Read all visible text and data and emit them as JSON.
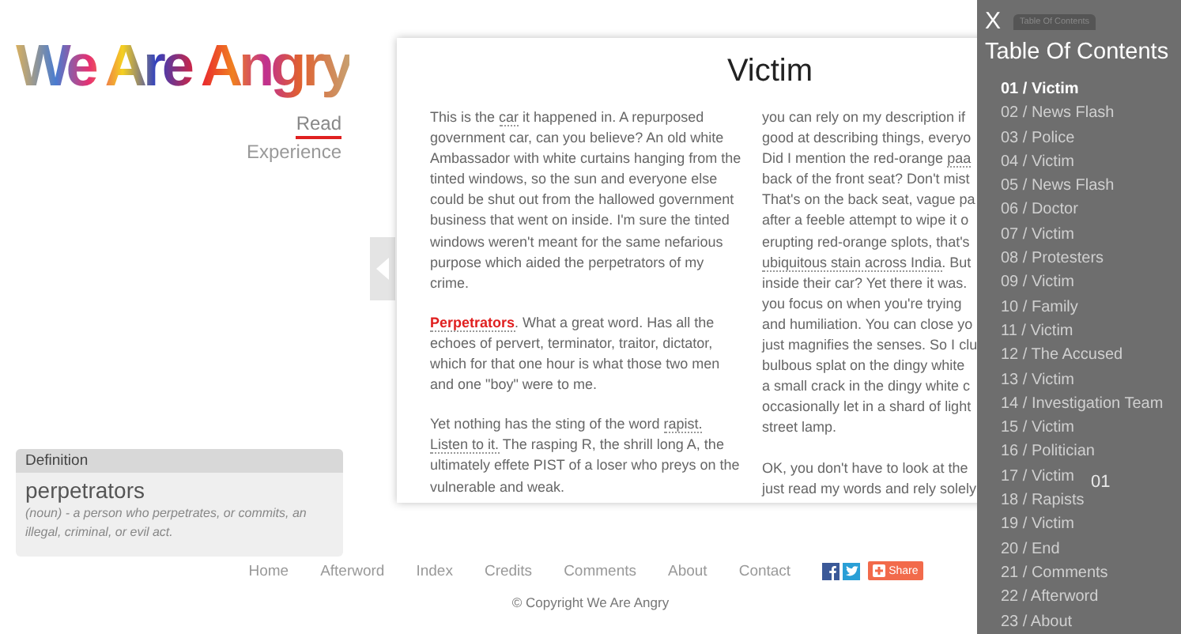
{
  "logo": {
    "text": "We Are Angry"
  },
  "side_nav": [
    {
      "label": "Read",
      "selected": true
    },
    {
      "label": "Experience",
      "selected": false
    }
  ],
  "definition": {
    "header": "Definition",
    "word": "perpetrators",
    "meaning": "(noun) - a person who perpetrates, or commits, an illegal, criminal, or evil act."
  },
  "article": {
    "title": "Victim",
    "left_column": [
      [
        {
          "kind": "text",
          "text": "This is the "
        },
        {
          "kind": "term",
          "text": "car"
        },
        {
          "kind": "text",
          "text": " it happened in. A repurposed government car, can you believe? An old white Ambassador with white curtains hanging from the tinted windows, so the sun and everyone else could be shut out from the hallowed government business that went on inside. I'm sure the tinted windows weren't meant for the same nefarious purpose which aided the perpetrators of my crime."
        }
      ],
      [
        {
          "kind": "term-active",
          "text": "Perpetrators"
        },
        {
          "kind": "text",
          "text": ". What a great word. Has all the echoes of pervert, terminator, traitor, dictator, which for that one hour is what those two men and one \"boy\" were to me."
        }
      ],
      [
        {
          "kind": "text",
          "text": "Yet nothing has the sting of the word "
        },
        {
          "kind": "term",
          "text": "rapist."
        },
        {
          "kind": "term",
          "text": "Listen to it.",
          "space_before": true
        },
        {
          "kind": "text",
          "text": " The rasping R, the shrill long A, the ultimately effete PIST of a loser who preys on the vulnerable and weak."
        }
      ]
    ],
    "right_column": [
      [
        [
          {
            "kind": "text",
            "text": "you can rely on my description if"
          }
        ],
        [
          {
            "kind": "text",
            "text": "good at describing things, everyo"
          }
        ],
        [
          {
            "kind": "text",
            "text": "Did I mention the red-orange "
          },
          {
            "kind": "term",
            "text": "paa"
          }
        ],
        [
          {
            "kind": "text",
            "text": "back of the front seat? Don't mist"
          }
        ],
        [
          {
            "kind": "text",
            "text": "That's on the back seat, vague pa"
          }
        ],
        [
          {
            "kind": "text",
            "text": "after a feeble attempt to wipe it o"
          }
        ],
        [
          {
            "kind": "text",
            "text": "erupting red-orange splots, that's"
          }
        ],
        [
          {
            "kind": "term",
            "text": "ubiquitous stain across India"
          },
          {
            "kind": "text",
            "text": ". But"
          }
        ],
        [
          {
            "kind": "text",
            "text": "inside their car? Yet there it was."
          }
        ],
        [
          {
            "kind": "text",
            "text": "you focus on when you're trying"
          }
        ],
        [
          {
            "kind": "text",
            "text": "and humiliation. You can close yo"
          }
        ],
        [
          {
            "kind": "text",
            "text": "just magnifies the senses. So I clu"
          }
        ],
        [
          {
            "kind": "text",
            "text": "bulbous splat on the dingy white"
          }
        ],
        [
          {
            "kind": "text",
            "text": "a small crack in the dingy white c"
          }
        ],
        [
          {
            "kind": "text",
            "text": "occasionally let in a shard of light"
          }
        ],
        [
          {
            "kind": "text",
            "text": "street lamp."
          }
        ]
      ],
      [
        [
          {
            "kind": "text",
            "text": "OK, you don't have to look at the"
          }
        ],
        [
          {
            "kind": "text",
            "text": "just read my words and rely solely"
          }
        ]
      ]
    ],
    "page_number": "01"
  },
  "footer": {
    "links": [
      "Home",
      "Afterword",
      "Index",
      "Credits",
      "Comments",
      "About",
      "Contact"
    ],
    "social": [
      {
        "kind": "facebook"
      },
      {
        "kind": "twitter"
      },
      {
        "kind": "share",
        "label": "Share"
      }
    ],
    "copyright": "© Copyright We Are Angry"
  },
  "toc": {
    "close": "X",
    "tab": "Table Of Contents",
    "title": "Table Of Contents",
    "items": [
      {
        "label": "01 / Victim",
        "selected": true
      },
      {
        "label": "02 / News Flash",
        "selected": false
      },
      {
        "label": "03 / Police",
        "selected": false
      },
      {
        "label": "04 / Victim",
        "selected": false
      },
      {
        "label": "05 / News Flash",
        "selected": false
      },
      {
        "label": "06 / Doctor",
        "selected": false
      },
      {
        "label": "07 / Victim",
        "selected": false
      },
      {
        "label": "08 / Protesters",
        "selected": false
      },
      {
        "label": "09 / Victim",
        "selected": false
      },
      {
        "label": "10 / Family",
        "selected": false
      },
      {
        "label": "11 / Victim",
        "selected": false
      },
      {
        "label": "12 / The Accused",
        "selected": false
      },
      {
        "label": "13 / Victim",
        "selected": false
      },
      {
        "label": "14 / Investigation Team",
        "selected": false
      },
      {
        "label": "15 / Victim",
        "selected": false
      },
      {
        "label": "16 / Politician",
        "selected": false
      },
      {
        "label": "17 / Victim",
        "selected": false
      },
      {
        "label": "18 / Rapists",
        "selected": false
      },
      {
        "label": "19 / Victim",
        "selected": false
      },
      {
        "label": "20 / End",
        "selected": false
      },
      {
        "label": "21 / Comments",
        "selected": false
      },
      {
        "label": "22 / Afterword",
        "selected": false
      },
      {
        "label": "23 / About",
        "selected": false
      }
    ]
  }
}
